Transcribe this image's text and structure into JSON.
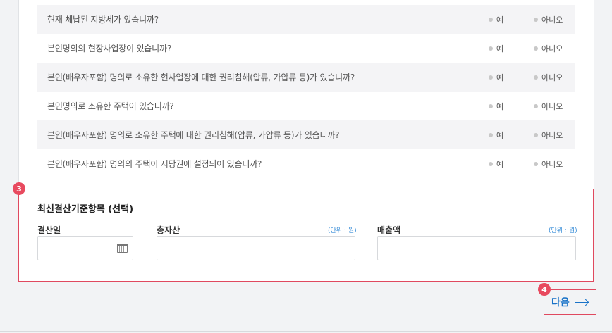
{
  "questions": [
    {
      "text": "현재 체납된 지방세가 있습니까?",
      "yes": "예",
      "no": "아니오"
    },
    {
      "text": "본인명의의 현장사업장이 있습니까?",
      "yes": "예",
      "no": "아니오"
    },
    {
      "text": "본인(배우자포함) 명의로 소유한 현사업장에 대한 권리침해(압류, 가압류 등)가 있습니까?",
      "yes": "예",
      "no": "아니오"
    },
    {
      "text": "본인명의로 소유한 주택이 있습니까?",
      "yes": "예",
      "no": "아니오"
    },
    {
      "text": "본인(배우자포함) 명의로 소유한 주택에 대한 권리침해(압류, 가압류 등)가 있습니까?",
      "yes": "예",
      "no": "아니오"
    },
    {
      "text": "본인(배우자포함) 명의의 주택이 저당권에 설정되어 있습니까?",
      "yes": "예",
      "no": "아니오"
    }
  ],
  "section3": {
    "badge": "3",
    "title": "최신결산기준항목 (선택)",
    "fields": {
      "settlement_date": {
        "label": "결산일",
        "value": ""
      },
      "total_assets": {
        "label": "총자산",
        "unit": "(단위 : 원)",
        "value": ""
      },
      "sales": {
        "label": "매출액",
        "unit": "(단위 : 원)",
        "value": ""
      }
    }
  },
  "next": {
    "badge": "4",
    "label": "다음"
  },
  "colors": {
    "accent_red": "#e0495f",
    "link_blue": "#1a73c8",
    "unit_blue": "#3a8ed8"
  }
}
